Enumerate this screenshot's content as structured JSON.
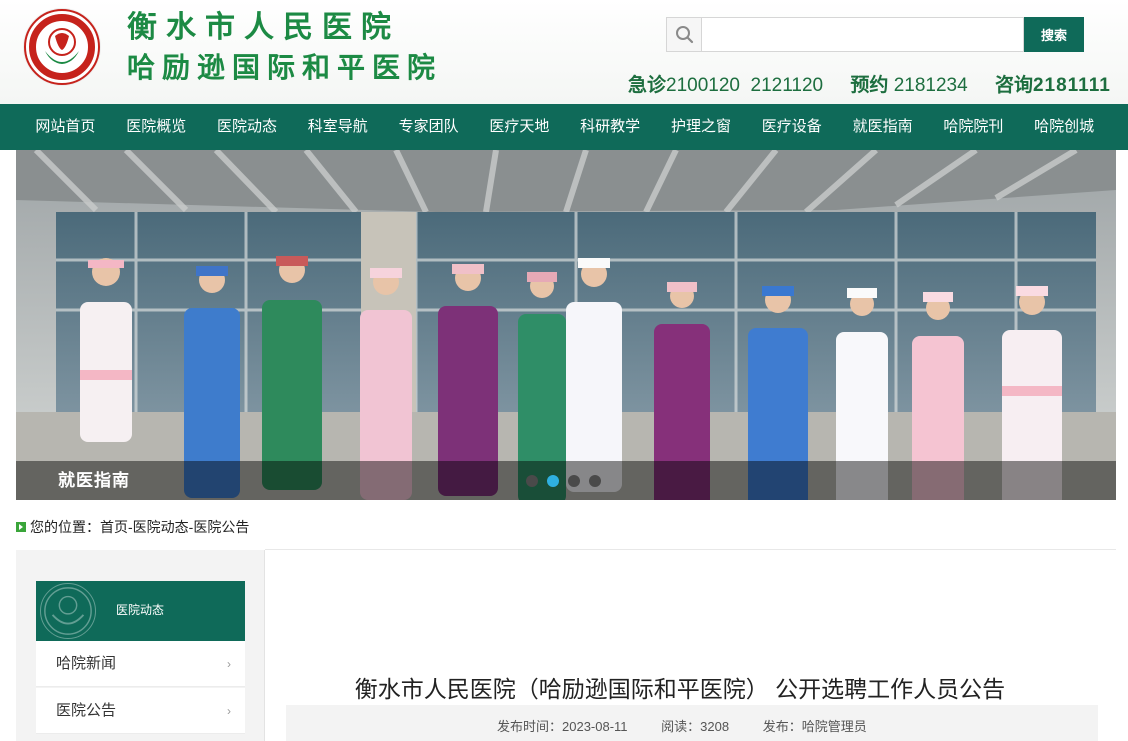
{
  "header": {
    "title_line1": "衡水市人民医院",
    "title_line2": "哈励逊国际和平医院",
    "search": {
      "placeholder": "",
      "button_label": "搜索"
    },
    "hotline": {
      "emergency_label": "急诊",
      "emergency_numbers": "2100120  2121120",
      "appointment_label": "预约",
      "appointment_number": "2181234",
      "consult_label": "咨询",
      "consult_number": "2181111"
    }
  },
  "nav": {
    "items": [
      "网站首页",
      "医院概览",
      "医院动态",
      "科室导航",
      "专家团队",
      "医疗天地",
      "科研教学",
      "护理之窗",
      "医疗设备",
      "就医指南",
      "哈院院刊",
      "哈院创城"
    ]
  },
  "banner": {
    "caption": "就医指南",
    "slide_count": 4,
    "active_slide": 2,
    "colors": {
      "caption_bar": "rgba(0,0,0,0.45)",
      "dot_active": "#2fb0e0",
      "dot": "#4a4a4a"
    }
  },
  "breadcrumb": {
    "prefix": "您的位置：",
    "items": [
      "首页",
      " -医院动态",
      " -医院公告"
    ]
  },
  "sidebar": {
    "title": "医院动态",
    "items": [
      "哈院新闻",
      "医院公告"
    ]
  },
  "article": {
    "title": "衡水市人民医院（哈励逊国际和平医院） 公开选聘工作人员公告",
    "meta": {
      "date": "发布时间：2023-08-11",
      "reads": "阅读：3208",
      "publisher": "发布：哈院管理员"
    }
  },
  "theme": {
    "primary": "#0f6a59",
    "title_green": "#1c8a44",
    "hotline_green": "#1d6e3f",
    "logo_red": "#c6231c"
  }
}
